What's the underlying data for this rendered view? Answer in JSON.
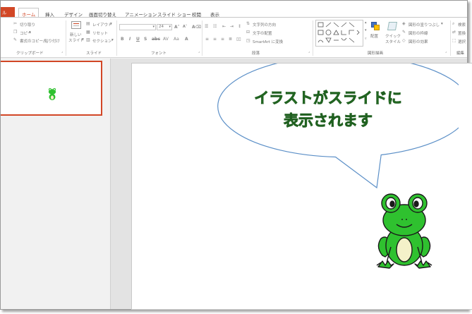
{
  "ribbon_tabs": {
    "file_initial": "ル",
    "home": "ホーム",
    "insert": "挿入",
    "design": "デザイン",
    "transitions": "画面切り替え",
    "animations": "アニメーション",
    "slideshow": "スライド ショー",
    "review": "校閲",
    "view": "表示"
  },
  "clipboard": {
    "cut": "切り取り",
    "copy": "コピー",
    "format_painter": "書式のコピー/貼り付け",
    "label": "クリップボード"
  },
  "slides_group": {
    "new_slide_line1": "新しい",
    "new_slide_line2": "スライド",
    "layout": "レイアウト",
    "reset": "リセット",
    "section": "セクション",
    "label": "スライド"
  },
  "font_group": {
    "font_name": "",
    "font_size": "24",
    "label": "フォント"
  },
  "paragraph_group": {
    "text_direction": "文字列の方向",
    "align_text": "文字の配置",
    "smartart": "SmartArt に変換",
    "label": "段落"
  },
  "drawing_group": {
    "arrange": "配置",
    "quick_styles_line1": "クイック",
    "quick_styles_line2": "スタイル",
    "shape_fill": "図形の塗りつぶし",
    "shape_outline": "図形の枠線",
    "shape_effects": "図形の効果",
    "label": "図形描画"
  },
  "editing_group": {
    "find": "検索",
    "replace": "置換",
    "select": "選択",
    "label": "編集"
  },
  "slide": {
    "bubble_line1": "イラストがスライドに",
    "bubble_line2": "表示されます"
  },
  "colors": {
    "accent": "#d24726",
    "bubble_border": "#5b8fc7",
    "bubble_text": "#3fa33a",
    "frog_green": "#2fc12f"
  }
}
